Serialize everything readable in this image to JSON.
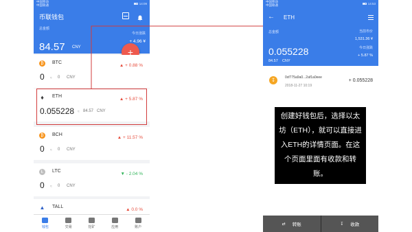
{
  "left_screen": {
    "status": {
      "carrier_top": "中国移动",
      "carrier_bottom": "中国联通",
      "time": "14:09"
    },
    "title": "币联钱包",
    "total_label": "总金额",
    "total_value": "84.57",
    "currency": "CNY",
    "today_label": "今日涨跌",
    "today_change": "+ 4.96 ¥",
    "fab_label": "+",
    "assets": [
      {
        "name": "BTC",
        "change": "+ 0.88 %",
        "direction": "up",
        "amount": "0",
        "approx": "≈",
        "fiat": "0",
        "fiat_currency": "CNY",
        "color": "#f7931a",
        "icon": "bitcoin-icon"
      },
      {
        "name": "ETH",
        "change": "+ 5.87 %",
        "direction": "up",
        "amount": "0.055228",
        "approx": "≈",
        "fiat": "84.57",
        "fiat_currency": "CNY",
        "color": "#3c3c3d",
        "icon": "ethereum-icon"
      },
      {
        "name": "BCH",
        "change": "+ 11.57 %",
        "direction": "up",
        "amount": "0",
        "approx": "≈",
        "fiat": "0",
        "fiat_currency": "CNY",
        "color": "#f7931a",
        "icon": "bitcoin-cash-icon"
      },
      {
        "name": "LTC",
        "change": "- 2.04 %",
        "direction": "down",
        "amount": "0",
        "approx": "≈",
        "fiat": "0",
        "fiat_currency": "CNY",
        "color": "#bebebe",
        "icon": "litecoin-icon"
      },
      {
        "name": "TALL",
        "change": "0.0 %",
        "direction": "up",
        "amount": "",
        "approx": "",
        "fiat": "",
        "fiat_currency": "",
        "color": "#2f62c7",
        "icon": "tall-icon"
      }
    ],
    "nav": [
      "钱包",
      "交易",
      "挖矿",
      "应用",
      "账户"
    ]
  },
  "right_screen": {
    "status": {
      "carrier_top": "中国移动",
      "carrier_bottom": "中国联通",
      "time": "14:53"
    },
    "title": "ETH",
    "total_label": "总金额",
    "latest_label": "当前市价",
    "latest_value": "1,531.36 ¥",
    "today_label": "今日涨跌",
    "today_value": "+ 5.87 %",
    "amount": "0.055228",
    "fiat": "84.57",
    "currency": "CNY",
    "transaction": {
      "hash": "0xf775a9a0...2af1a0eee",
      "date": "2018-11-27 10:19",
      "amount": "+ 0.055228"
    },
    "actions": {
      "transfer": "转账",
      "receive": "收款"
    }
  },
  "caption": "创建好钱包后，选择以太坊（ETH），就可以直接进入ETH的详情页面。在这个页面里面有收款和转账。",
  "colors": {
    "primary": "#3a7de8",
    "up": "#e64c3c",
    "down": "#2eb357",
    "highlight": "#d23b3b",
    "fab": "#ee5a4e"
  }
}
